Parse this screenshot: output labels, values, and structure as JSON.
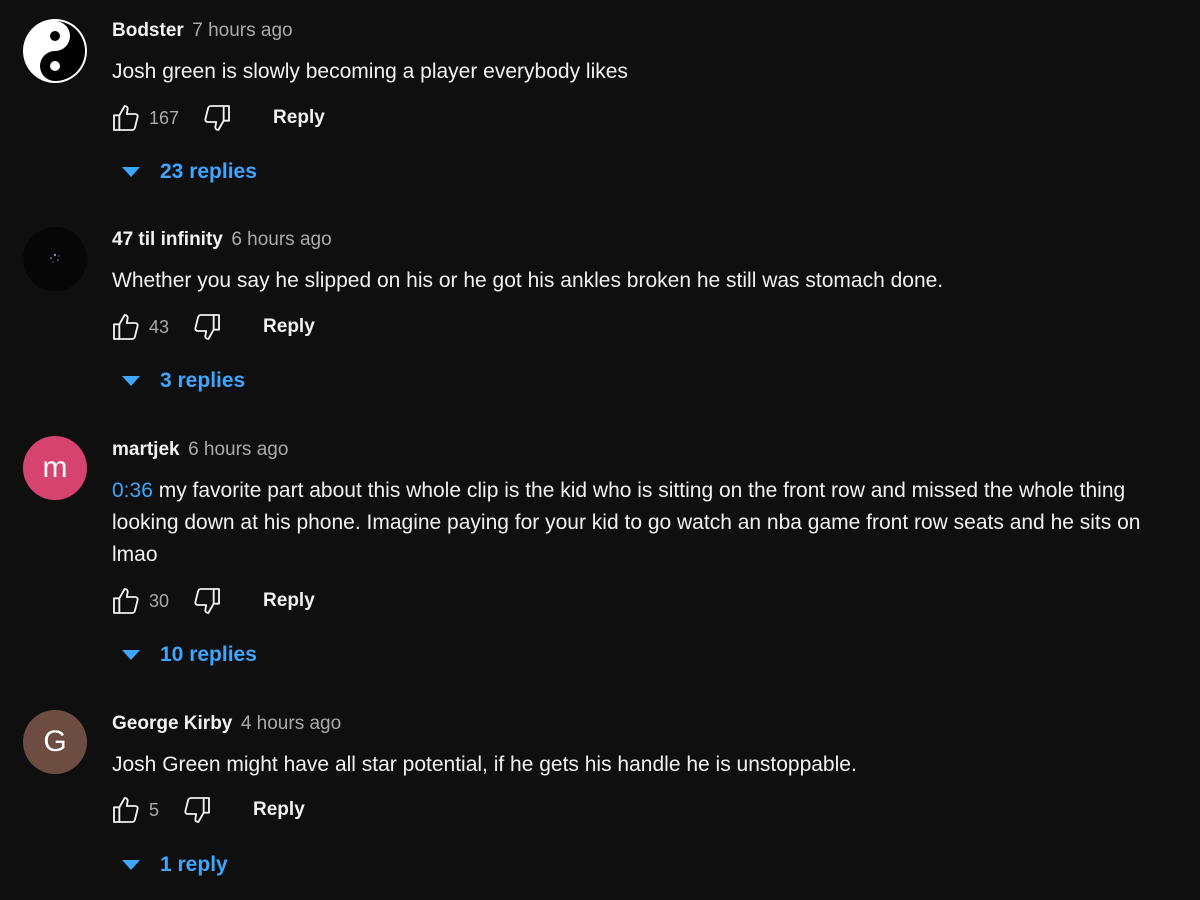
{
  "comments": [
    {
      "author": "Bodster",
      "time": "7 hours ago",
      "avatar_icon": "yin-yang-icon",
      "text": "Josh green is slowly becoming a player everybody likes",
      "likes": "167",
      "reply_label": "Reply",
      "replies_label": "23 replies"
    },
    {
      "author": "47 til infinity",
      "time": "6 hours ago",
      "avatar_icon": "dark-sparkle-avatar",
      "text": "Whether you say he slipped on his or he got his ankles broken he still was stomach done.",
      "likes": "43",
      "reply_label": "Reply",
      "replies_label": "3 replies"
    },
    {
      "author": "martjek",
      "time": "6 hours ago",
      "avatar_letter": "m",
      "avatar_color": "#d6436f",
      "timestamp_link": "0:36",
      "text_line1": " my favorite part about this whole clip is the kid who is sitting on the front row and missed the whole thing",
      "text_line2": "looking down at his phone. Imagine paying for your kid to go watch an nba game front row seats and he sits on",
      "text_line3": "lmao",
      "likes": "30",
      "reply_label": "Reply",
      "replies_label": "10 replies"
    },
    {
      "author": "George Kirby",
      "time": "4 hours ago",
      "avatar_letter": "G",
      "avatar_color": "#6d4c41",
      "text": "Josh Green might have all star potential, if he gets his handle he is unstoppable.",
      "likes": "5",
      "reply_label": "Reply",
      "replies_label": "1 reply"
    }
  ],
  "colors": {
    "background": "#0f0f0f",
    "link_blue": "#3ea6ff",
    "secondary_text": "#aaaaaa"
  }
}
